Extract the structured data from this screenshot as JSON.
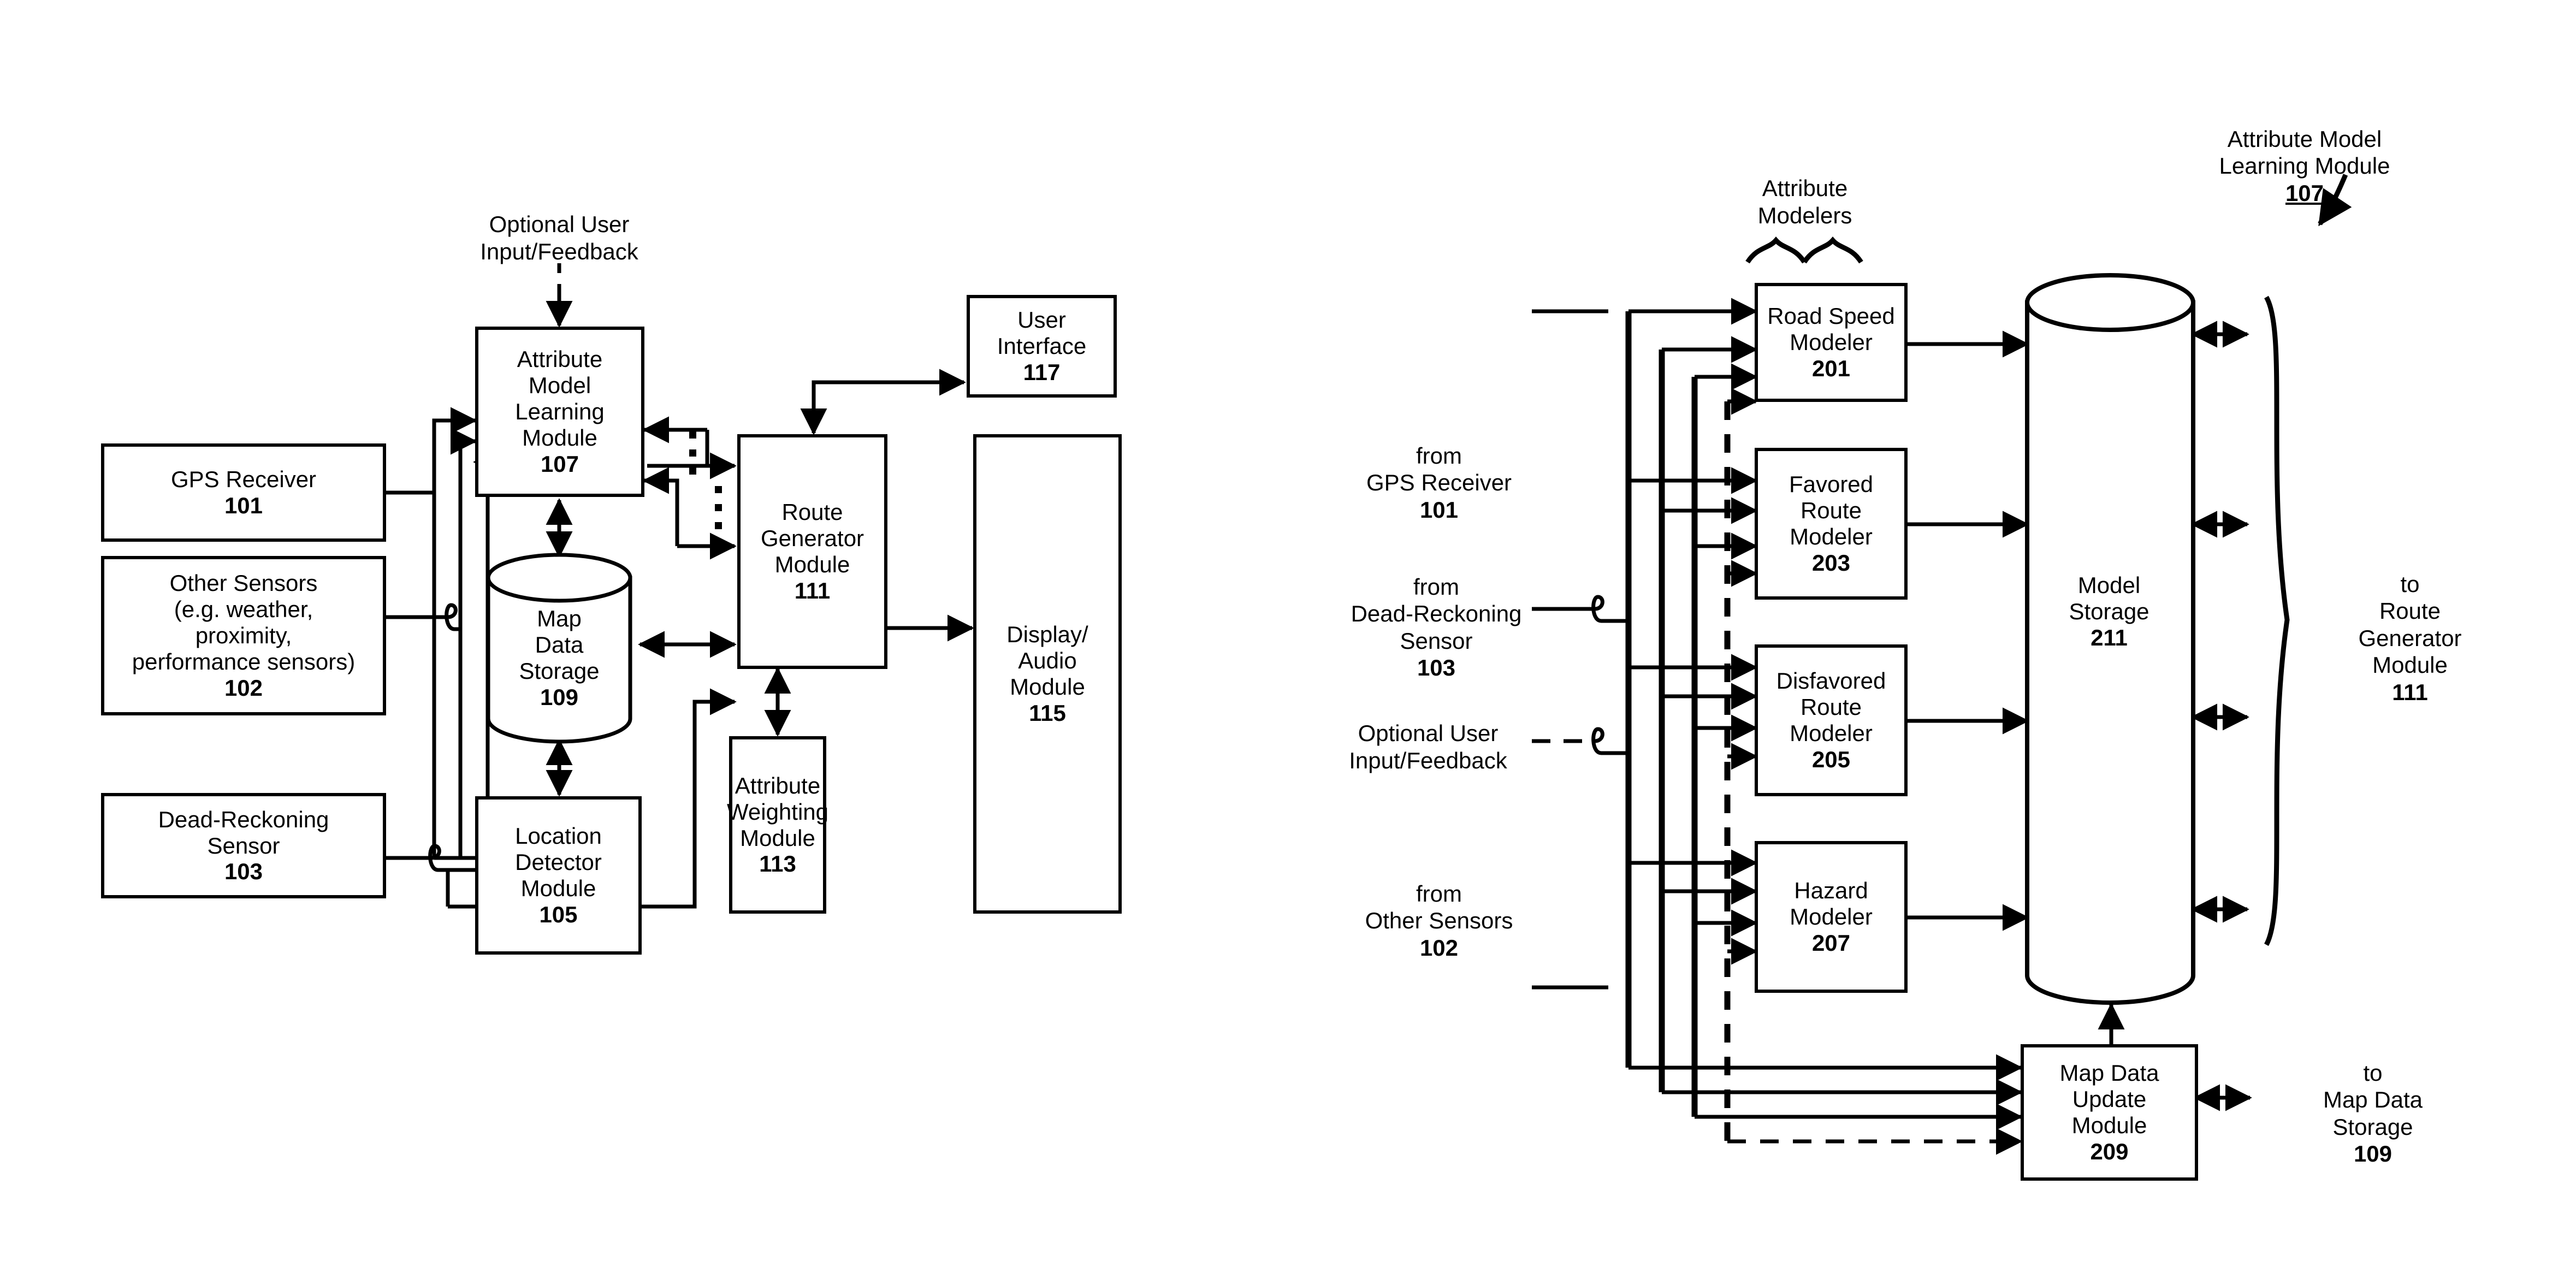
{
  "figure_left": {
    "boxes": {
      "gps_receiver": {
        "title": "GPS Receiver",
        "num": "101"
      },
      "other_sensors": {
        "title": "Other Sensors\n(e.g. weather,\nproximity,\nperformance sensors)",
        "num": "102"
      },
      "dead_reckoning": {
        "title": "Dead-Reckoning\nSensor",
        "num": "103"
      },
      "attribute_model_learning": {
        "title": "Attribute\nModel\nLearning\nModule",
        "num": "107"
      },
      "map_data_storage": {
        "title": "Map\nData\nStorage",
        "num": "109"
      },
      "location_detector": {
        "title": "Location\nDetector\nModule",
        "num": "105"
      },
      "route_generator": {
        "title": "Route\nGenerator\nModule",
        "num": "111"
      },
      "attribute_weighting": {
        "title": "Attribute\nWeighting\nModule",
        "num": "113"
      },
      "display_audio": {
        "title": "Display/\nAudio\nModule",
        "num": "115"
      },
      "user_interface": {
        "title": "User\nInterface",
        "num": "117"
      }
    },
    "labels": {
      "optional_user_input": "Optional User\nInput/Feedback"
    }
  },
  "figure_right": {
    "boxes": {
      "road_speed_modeler": {
        "title": "Road Speed\nModeler",
        "num": "201"
      },
      "favored_route_modeler": {
        "title": "Favored\nRoute\nModeler",
        "num": "203"
      },
      "disfavored_route_modeler": {
        "title": "Disfavored\nRoute\nModeler",
        "num": "205"
      },
      "hazard_modeler": {
        "title": "Hazard\nModeler",
        "num": "207"
      },
      "map_data_update": {
        "title": "Map Data\nUpdate\nModule",
        "num": "209"
      },
      "model_storage": {
        "title": "Model\nStorage",
        "num": "211"
      }
    },
    "labels": {
      "attribute_modelers": "Attribute\nModelers",
      "attribute_model_learning_module": "Attribute Model\nLearning Module",
      "attribute_model_learning_module_num": "107",
      "from_gps": "from\nGPS Receiver",
      "from_gps_num": "101",
      "from_dead_reckoning": "from\nDead-Reckoning\nSensor",
      "from_dead_reckoning_num": "103",
      "optional_user_input": "Optional User\nInput/Feedback",
      "from_other_sensors": "from\nOther Sensors",
      "from_other_sensors_num": "102",
      "to_route_generator": "to\nRoute\nGenerator\nModule",
      "to_route_generator_num": "111",
      "to_map_data_storage": "to\nMap Data\nStorage",
      "to_map_data_storage_num": "109"
    }
  },
  "style": {
    "line_color": "#000000",
    "background": "#ffffff"
  }
}
